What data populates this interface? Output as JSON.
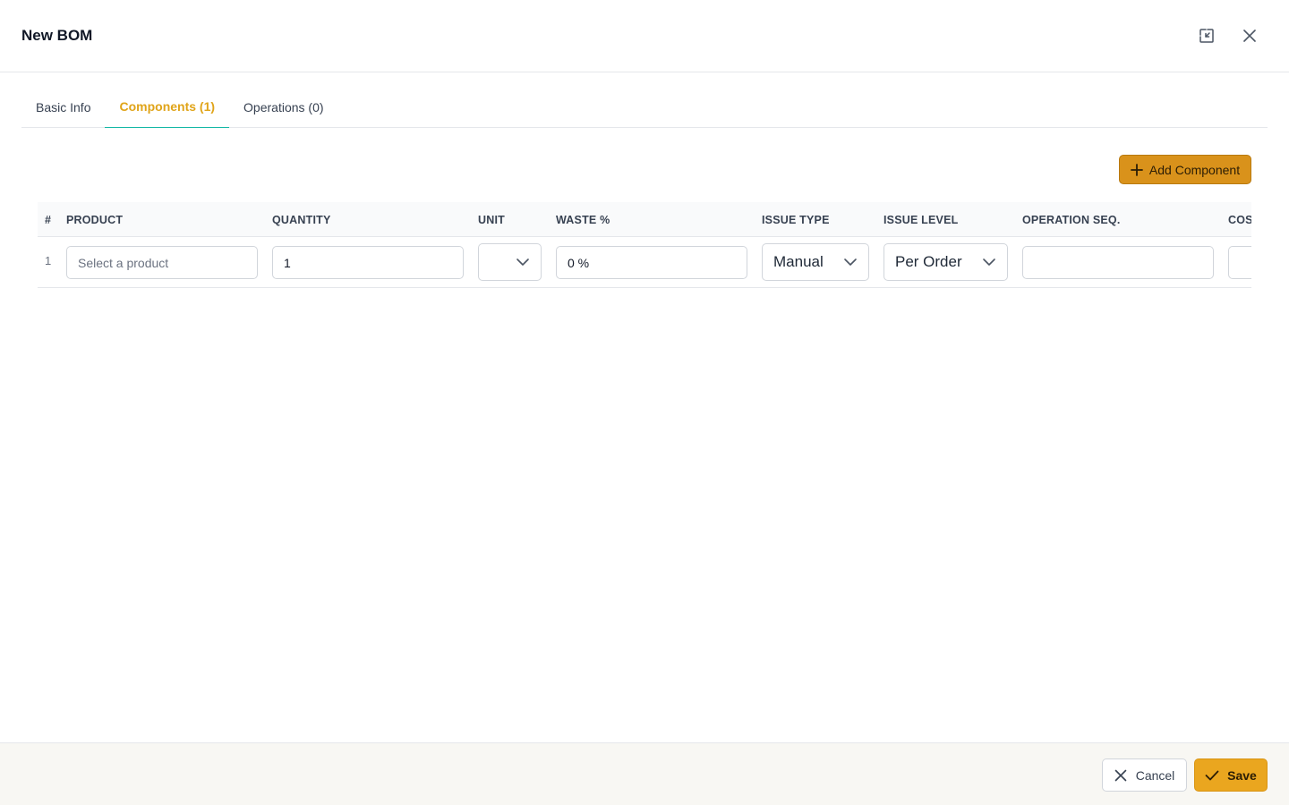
{
  "modal": {
    "title": "New BOM"
  },
  "tabs": [
    {
      "label": "Basic Info",
      "active": false
    },
    {
      "label": "Components (1)",
      "active": true
    },
    {
      "label": "Operations (0)",
      "active": false
    }
  ],
  "toolbar": {
    "add_component_label": "Add Component"
  },
  "table": {
    "columns": [
      "#",
      "PRODUCT",
      "QUANTITY",
      "UNIT",
      "WASTE %",
      "ISSUE TYPE",
      "ISSUE LEVEL",
      "OPERATION SEQ.",
      "COS"
    ],
    "rows": [
      {
        "index": "1",
        "product_placeholder": "Select a product",
        "quantity": "1",
        "unit": "",
        "waste": "0 %",
        "issue_type": "Manual",
        "issue_level": "Per Order",
        "operation_seq": "",
        "cost": ""
      }
    ]
  },
  "footer": {
    "cancel_label": "Cancel",
    "save_label": "Save"
  },
  "colors": {
    "accent": "#e0a419",
    "tab_underline": "#14b8a6",
    "add_button": "#d9921b",
    "save_button": "#eaa61f"
  }
}
